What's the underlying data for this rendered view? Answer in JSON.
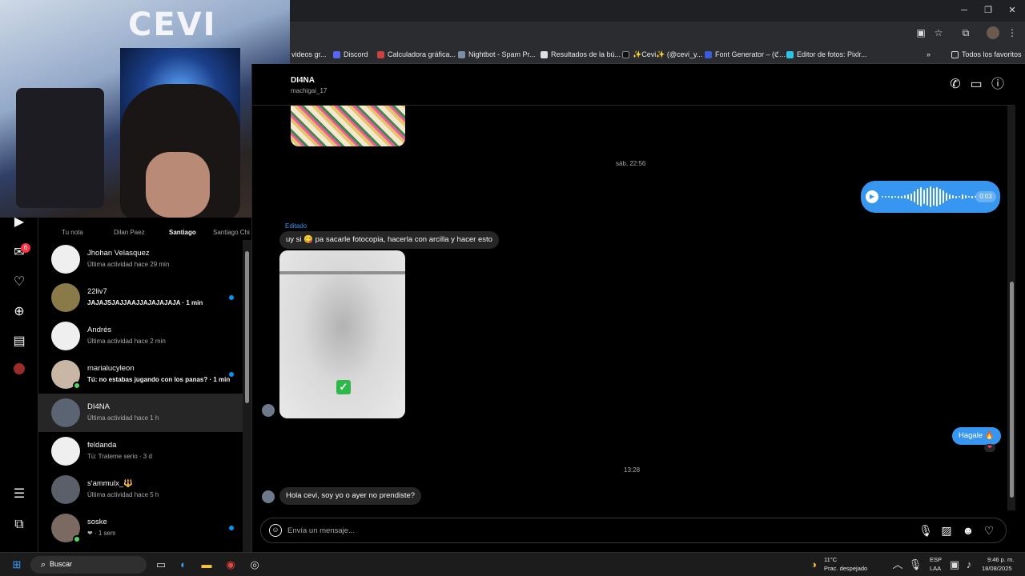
{
  "bookmarks": [
    {
      "label": "videos gr...",
      "color": "#7f7f7f"
    },
    {
      "label": "Discord",
      "color": "#5865f2"
    },
    {
      "label": "Calculadora gráfica...",
      "color": "#c94141"
    },
    {
      "label": "Nightbot - Spam Pr...",
      "color": "#7a8fa6"
    },
    {
      "label": "Resultados de la bú...",
      "color": "#e0e0e0"
    },
    {
      "label": "✨Cevi✨ (@cevi_y...",
      "color": "#111111"
    },
    {
      "label": "Font Generator – (ℭ...",
      "color": "#3b5bdb"
    },
    {
      "label": "Editor de fotos: Pixlr...",
      "color": "#2ec4e6"
    }
  ],
  "bookmarks_all": "Todos los favoritos",
  "webcam": {
    "sign": "CEVI"
  },
  "rail": {
    "messages_badge": "6"
  },
  "notes": [
    {
      "label": "Tu nota",
      "bold": false
    },
    {
      "label": "Dilan Paez",
      "bold": false
    },
    {
      "label": "Santiago",
      "bold": true
    },
    {
      "label": "Santiago Chi",
      "bold": false
    }
  ],
  "conversations": [
    {
      "name": "Jhohan Velasquez",
      "sub": "Última actividad hace 29 min",
      "unread": false,
      "online": false,
      "dot": false,
      "avatar": "#efefef"
    },
    {
      "name": "22liv7",
      "sub": "JAJAJSJAJJAAJJAJAJAJAJA · 1 min",
      "unread": true,
      "online": false,
      "dot": true,
      "avatar": "#8a7a4a"
    },
    {
      "name": "Andrés",
      "sub": "Última actividad hace 2 min",
      "unread": false,
      "online": false,
      "dot": false,
      "avatar": "#efefef"
    },
    {
      "name": "marialucyleon",
      "sub": "Tú: no estabas jugando con los panas? · 1 min",
      "unread": true,
      "online": true,
      "dot": true,
      "avatar": "#c9b7a6"
    },
    {
      "name": "DI4NA",
      "sub": "Última actividad hace 1 h",
      "unread": false,
      "online": false,
      "dot": false,
      "avatar": "#5a6472",
      "active": true
    },
    {
      "name": "feldanda",
      "sub": "Tú: Trateme serio · 3 d",
      "unread": false,
      "online": false,
      "dot": false,
      "avatar": "#efefef"
    },
    {
      "name": "s'ammulx_🔱",
      "sub": "Última actividad hace 5 h",
      "unread": false,
      "online": false,
      "dot": false,
      "avatar": "#5a5f6a"
    },
    {
      "name": "soske",
      "sub": "❤ · 1 sem",
      "unread": false,
      "online": true,
      "dot": true,
      "avatar": "#7a6a62"
    }
  ],
  "chat": {
    "name": "DI4NA",
    "username": "machigai_17",
    "timestamp_1": "sáb, 22:56",
    "voice_duration": "0:03",
    "edited_label": "Editado",
    "message_1": "uy si 😋 pa sacarle fotocopia, hacerla con arcilla y hacer esto",
    "reply_out": "Hagale 🔥",
    "reaction": "❤",
    "timestamp_2": "13:28",
    "message_2": "Hola cevi, soy yo o ayer no prendiste?",
    "composer_placeholder": "Envía un mensaje..."
  },
  "taskbar": {
    "search_label": "Buscar",
    "weather_temp": "11°C",
    "weather_desc": "Prac. despejado",
    "lang_1": "ESP",
    "lang_2": "LAA",
    "time": "9:46 p. m.",
    "date": "18/08/2025"
  },
  "colors": {
    "accent": "#3797f0",
    "unread_dot": "#0095f6",
    "online": "#4cd963",
    "badge": "#ff3040"
  }
}
